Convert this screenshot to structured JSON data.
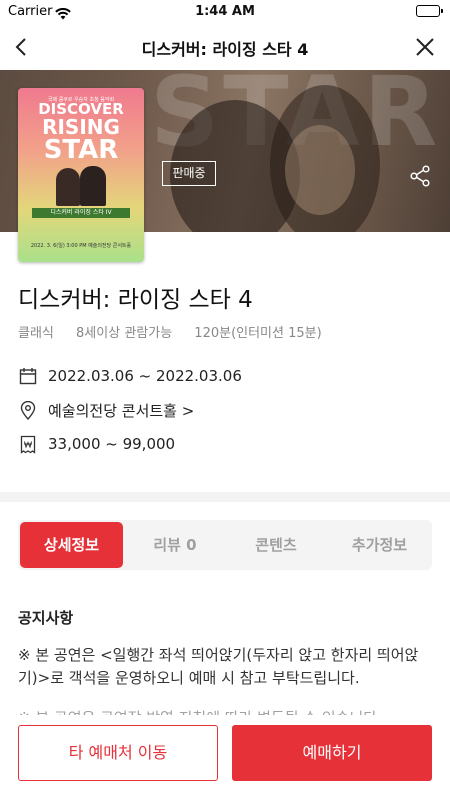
{
  "status_bar": {
    "carrier": "Carrier",
    "time": "1:44 AM"
  },
  "nav": {
    "title": "디스커버: 라이징 스타 4"
  },
  "poster": {
    "top_text": "국제 콩쿠르 우승자 초청 음악회",
    "title_line1": "DISCOVER",
    "title_line2": "RISING",
    "title_line3": "STAR",
    "band_text": "디스커버 라이징 스타 IV",
    "date_text": "2022. 3. 6(일) 3:00 PM 예술의전당 콘서트홀"
  },
  "hero": {
    "bg_text": "STAR",
    "badge": "판매중"
  },
  "event": {
    "title": "디스커버: 라이징 스타 4",
    "genre": "클래식",
    "age": "8세이상 관람가능",
    "runtime": "120분(인터미션 15분)",
    "dates": "2022.03.06 ~ 2022.03.06",
    "venue": "예술의전당 콘서트홀 >",
    "price": "33,000 ~ 99,000"
  },
  "tabs": [
    {
      "label": "상세정보",
      "active": true
    },
    {
      "label": "리뷰 0",
      "active": false
    },
    {
      "label": "콘텐츠",
      "active": false
    },
    {
      "label": "추가정보",
      "active": false
    }
  ],
  "notice": {
    "title": "공지사항",
    "body": "※ 본 공연은 <일행간 좌석 띄어앉기(두자리 앉고 한자리 띄어앉기)>로 객석을 운영하오니 예매 시 참고 부탁드립니다.",
    "more": "※ 본 공연은 공연장 방역 지침에 따라 변동될 수 있습니다."
  },
  "bottom": {
    "other_vendor": "타 예매처 이동",
    "book": "예매하기"
  },
  "colors": {
    "accent": "#e63139",
    "muted": "#888888",
    "tab_bg": "#f4f4f4"
  }
}
